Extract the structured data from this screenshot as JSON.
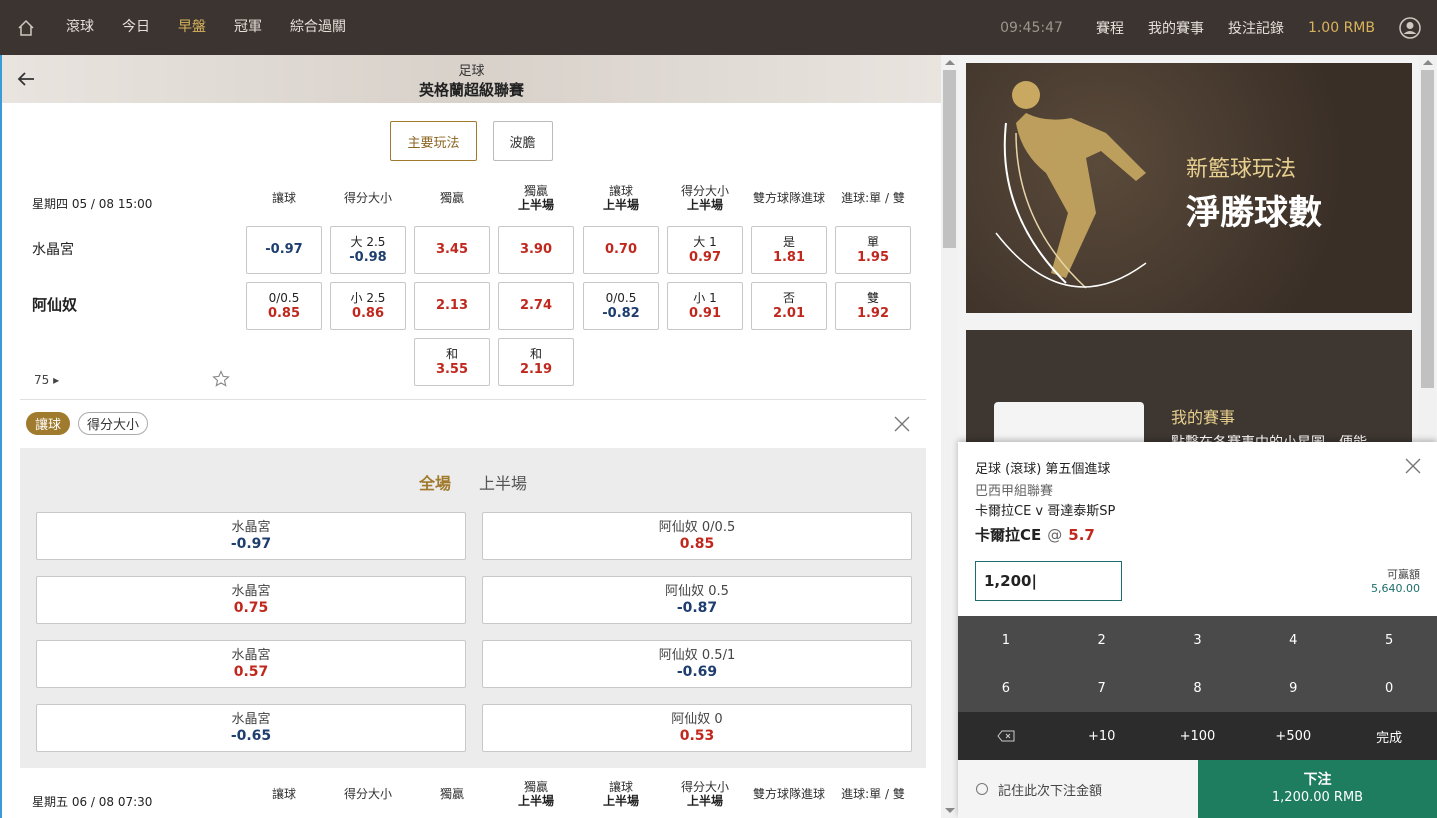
{
  "nav": {
    "items": [
      "滾球",
      "今日",
      "早盤",
      "冠軍",
      "綜合過關"
    ],
    "time": "09:45:47",
    "right_items": [
      "賽程",
      "我的賽事",
      "投注記錄"
    ],
    "balance": "1.00 RMB"
  },
  "league": {
    "sport": "足球",
    "name": "英格蘭超級聯賽"
  },
  "tabs": [
    "主要玩法",
    "波膽"
  ],
  "columns": [
    [
      "讓球",
      ""
    ],
    [
      "得分大小",
      ""
    ],
    [
      "獨贏",
      ""
    ],
    [
      "獨贏",
      "上半場"
    ],
    [
      "讓球",
      "上半場"
    ],
    [
      "得分大小",
      "上半場"
    ],
    [
      "雙方球隊進球",
      ""
    ],
    [
      "進球:單 / 雙",
      ""
    ]
  ],
  "match1": {
    "date": "星期四 05 / 08   15:00",
    "home": "水晶宮",
    "away": "阿仙奴",
    "id": "75",
    "home_odds": [
      [
        "",
        "-0.97",
        "blue"
      ],
      [
        "大 2.5",
        "-0.98",
        "blue"
      ],
      [
        "",
        "3.45",
        "red"
      ],
      [
        "",
        "3.90",
        "red"
      ],
      [
        "",
        "0.70",
        "red"
      ],
      [
        "大 1",
        "0.97",
        "red"
      ],
      [
        "是",
        "1.81",
        "red"
      ],
      [
        "單",
        "1.95",
        "red"
      ]
    ],
    "away_odds": [
      [
        "0/0.5",
        "0.85",
        "red"
      ],
      [
        "小 2.5",
        "0.86",
        "red"
      ],
      [
        "",
        "2.13",
        "red"
      ],
      [
        "",
        "2.74",
        "red"
      ],
      [
        "0/0.5",
        "-0.82",
        "blue"
      ],
      [
        "小 1",
        "0.91",
        "red"
      ],
      [
        "否",
        "2.01",
        "red"
      ],
      [
        "雙",
        "1.92",
        "red"
      ]
    ],
    "draw_odds": [
      [
        "和",
        "3.55",
        "red"
      ],
      [
        "和",
        "2.19",
        "red"
      ]
    ]
  },
  "pills": [
    "讓球",
    "得分大小"
  ],
  "handicap": {
    "tabs": [
      "全場",
      "上半場"
    ],
    "rows": [
      {
        "home": "水晶宮",
        "home_v": "-0.97",
        "home_c": "blue",
        "away": "阿仙奴 0/0.5",
        "away_v": "0.85",
        "away_c": "red"
      },
      {
        "home": "水晶宮",
        "home_v": "0.75",
        "home_c": "red",
        "away": "阿仙奴 0.5",
        "away_v": "-0.87",
        "away_c": "blue"
      },
      {
        "home": "水晶宮",
        "home_v": "0.57",
        "home_c": "red",
        "away": "阿仙奴 0.5/1",
        "away_v": "-0.69",
        "away_c": "blue"
      },
      {
        "home": "水晶宮",
        "home_v": "-0.65",
        "home_c": "blue",
        "away": "阿仙奴 0",
        "away_v": "0.53",
        "away_c": "red"
      }
    ]
  },
  "match2": {
    "date": "星期五 06 / 08   07:30"
  },
  "banners": {
    "b1_line1": "新籃球玩法",
    "b1_line2": "淨勝球數",
    "b2_line1": "我的賽事",
    "b2_line2": "點擊在各賽事中的小星圖，便能"
  },
  "slip": {
    "market": "足球 (滾球) 第五個進球",
    "league": "巴西甲組聯賽",
    "event": "卡爾拉CE v 哥達泰斯SP",
    "pick": "卡爾拉CE",
    "at": "@",
    "price": "5.7",
    "stake": "1,200|",
    "win_label": "可贏額",
    "win_value": "5,640.00",
    "keys": [
      "1",
      "2",
      "3",
      "4",
      "5",
      "6",
      "7",
      "8",
      "9",
      "0"
    ],
    "quick": [
      "+10",
      "+100",
      "+500",
      "完成"
    ],
    "remember": "記住此次下注金額",
    "place": "下注",
    "amount": "1,200.00 RMB"
  }
}
